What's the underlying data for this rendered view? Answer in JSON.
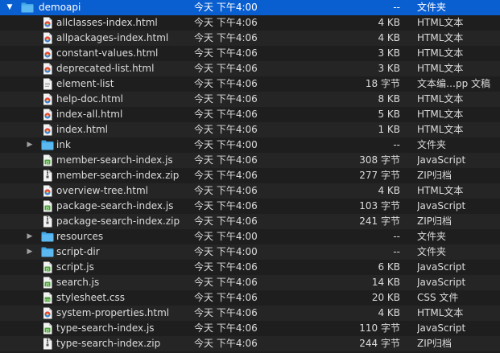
{
  "colors": {
    "background": "#1e1e1e",
    "row_alt": "#252525",
    "selection": "#0a5fd0",
    "folder": "#3fa7e8",
    "js_badge": "#4ca337",
    "html_badge": "#e44d26",
    "doc_page": "#f2f2f2"
  },
  "rows": [
    {
      "name": "demoapi",
      "date": "今天 下午4:00",
      "size": "--",
      "kind": "文件夹",
      "icon": "folder-icon",
      "disclosure": "expanded",
      "selected": true
    },
    {
      "name": "allclasses-index.html",
      "date": "今天 下午4:06",
      "size": "4 KB",
      "kind": "HTML文本",
      "icon": "html-file-icon"
    },
    {
      "name": "allpackages-index.html",
      "date": "今天 下午4:06",
      "size": "4 KB",
      "kind": "HTML文本",
      "icon": "html-file-icon"
    },
    {
      "name": "constant-values.html",
      "date": "今天 下午4:06",
      "size": "3 KB",
      "kind": "HTML文本",
      "icon": "html-file-icon"
    },
    {
      "name": "deprecated-list.html",
      "date": "今天 下午4:06",
      "size": "3 KB",
      "kind": "HTML文本",
      "icon": "html-file-icon"
    },
    {
      "name": "element-list",
      "date": "今天 下午4:06",
      "size": "18 字节",
      "kind": "文本编…pp 文稿",
      "icon": "document-icon"
    },
    {
      "name": "help-doc.html",
      "date": "今天 下午4:06",
      "size": "8 KB",
      "kind": "HTML文本",
      "icon": "html-file-icon"
    },
    {
      "name": "index-all.html",
      "date": "今天 下午4:06",
      "size": "5 KB",
      "kind": "HTML文本",
      "icon": "html-file-icon"
    },
    {
      "name": "index.html",
      "date": "今天 下午4:06",
      "size": "1 KB",
      "kind": "HTML文本",
      "icon": "html-file-icon"
    },
    {
      "name": "ink",
      "date": "今天 下午4:00",
      "size": "--",
      "kind": "文件夹",
      "icon": "folder-icon",
      "disclosure": "collapsed"
    },
    {
      "name": "member-search-index.js",
      "date": "今天 下午4:06",
      "size": "308 字节",
      "kind": "JavaScript",
      "icon": "js-file-icon"
    },
    {
      "name": "member-search-index.zip",
      "date": "今天 下午4:06",
      "size": "277 字节",
      "kind": "ZIP归档",
      "icon": "zip-file-icon"
    },
    {
      "name": "overview-tree.html",
      "date": "今天 下午4:06",
      "size": "4 KB",
      "kind": "HTML文本",
      "icon": "html-file-icon"
    },
    {
      "name": "package-search-index.js",
      "date": "今天 下午4:06",
      "size": "103 字节",
      "kind": "JavaScript",
      "icon": "js-file-icon"
    },
    {
      "name": "package-search-index.zip",
      "date": "今天 下午4:06",
      "size": "241 字节",
      "kind": "ZIP归档",
      "icon": "zip-file-icon"
    },
    {
      "name": "resources",
      "date": "今天 下午4:00",
      "size": "--",
      "kind": "文件夹",
      "icon": "folder-icon",
      "disclosure": "collapsed"
    },
    {
      "name": "script-dir",
      "date": "今天 下午4:00",
      "size": "--",
      "kind": "文件夹",
      "icon": "folder-icon",
      "disclosure": "collapsed"
    },
    {
      "name": "script.js",
      "date": "今天 下午4:06",
      "size": "6 KB",
      "kind": "JavaScript",
      "icon": "js-file-icon"
    },
    {
      "name": "search.js",
      "date": "今天 下午4:06",
      "size": "14 KB",
      "kind": "JavaScript",
      "icon": "js-file-icon"
    },
    {
      "name": "stylesheet.css",
      "date": "今天 下午4:06",
      "size": "20 KB",
      "kind": "CSS 文件",
      "icon": "css-file-icon"
    },
    {
      "name": "system-properties.html",
      "date": "今天 下午4:06",
      "size": "4 KB",
      "kind": "HTML文本",
      "icon": "html-file-icon"
    },
    {
      "name": "type-search-index.js",
      "date": "今天 下午4:06",
      "size": "110 字节",
      "kind": "JavaScript",
      "icon": "js-file-icon"
    },
    {
      "name": "type-search-index.zip",
      "date": "今天 下午4:06",
      "size": "244 字节",
      "kind": "ZIP归档",
      "icon": "zip-file-icon"
    }
  ]
}
